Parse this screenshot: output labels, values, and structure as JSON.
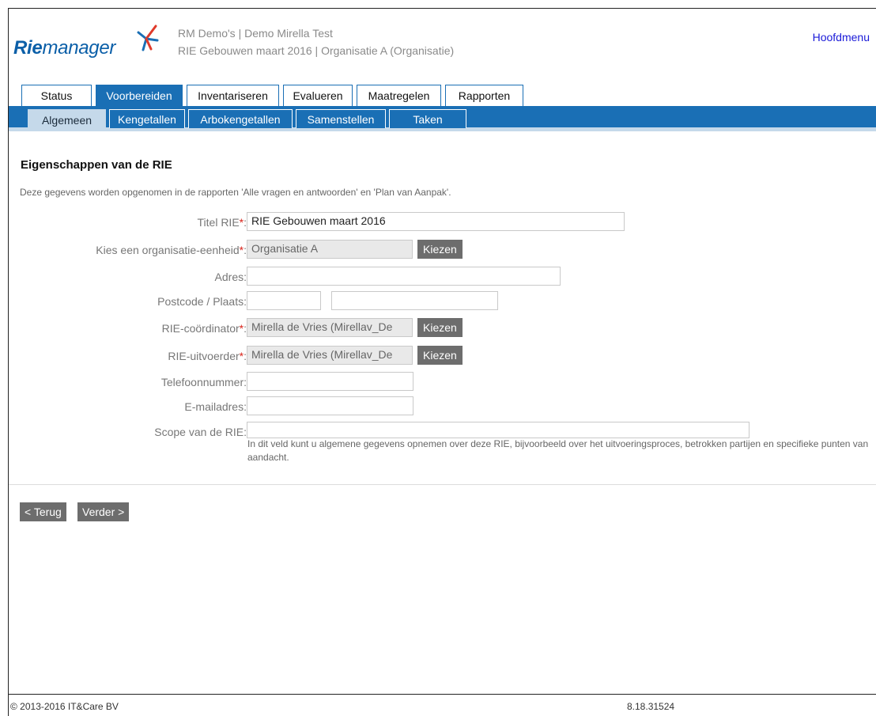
{
  "header": {
    "logo_text": "Riemanager",
    "context_line1": "RM Demo's  |  Demo Mirella Test",
    "context_line2": "RIE Gebouwen maart 2016  |  Organisatie A  (Organisatie)",
    "menu_link": "Hoofdmenu"
  },
  "main_tabs": [
    {
      "label": "Status",
      "active": false
    },
    {
      "label": "Voorbereiden",
      "active": true
    },
    {
      "label": "Inventariseren",
      "active": false
    },
    {
      "label": "Evalueren",
      "active": false
    },
    {
      "label": "Maatregelen",
      "active": false
    },
    {
      "label": "Rapporten",
      "active": false
    }
  ],
  "sub_tabs": [
    {
      "label": "Algemeen",
      "active": true
    },
    {
      "label": "Kengetallen",
      "active": false
    },
    {
      "label": "Arbokengetallen",
      "active": false
    },
    {
      "label": "Samenstellen",
      "active": false
    },
    {
      "label": "Taken",
      "active": false
    }
  ],
  "page": {
    "title": "Eigenschappen van de RIE",
    "intro": "Deze gegevens worden opgenomen in de rapporten 'Alle vragen en antwoorden' en 'Plan van Aanpak'."
  },
  "form": {
    "titel_label": "Titel RIE",
    "titel_value": "RIE Gebouwen maart 2016",
    "org_label": "Kies een organisatie-eenheid",
    "org_value": "Organisatie A",
    "adres_label": "Adres:",
    "adres_value": "",
    "postcode_label": "Postcode / Plaats:",
    "postcode_value": "",
    "plaats_value": "",
    "coordinator_label": "RIE-coördinator",
    "coordinator_value": "Mirella de Vries (Mirellav_De",
    "uitvoerder_label": "RIE-uitvoerder",
    "uitvoerder_value": "Mirella de Vries (Mirellav_De",
    "telefoon_label": "Telefoonnummer:",
    "telefoon_value": "",
    "email_label": "E-mailadres:",
    "email_value": "",
    "scope_label": "Scope van de RIE:",
    "scope_value": "",
    "scope_hint": "In dit veld kunt u algemene gegevens opnemen over deze RIE, bijvoorbeeld over het uitvoeringsproces, betrokken partijen en specifieke punten van aandacht.",
    "choose_label": "Kiezen",
    "required_mark": "*",
    "colon": ":"
  },
  "nav": {
    "back_label": "< Terug",
    "next_label": "Verder >"
  },
  "footer": {
    "copyright": "© 2013-2016 IT&Care BV",
    "version": "8.18.31524"
  },
  "colors": {
    "brand_blue": "#1a6fb5",
    "logo_blue": "#0b5fa8",
    "required_red": "#d9251c",
    "button_grey": "#6d6d6d",
    "link_blue": "#1a1ad8"
  }
}
